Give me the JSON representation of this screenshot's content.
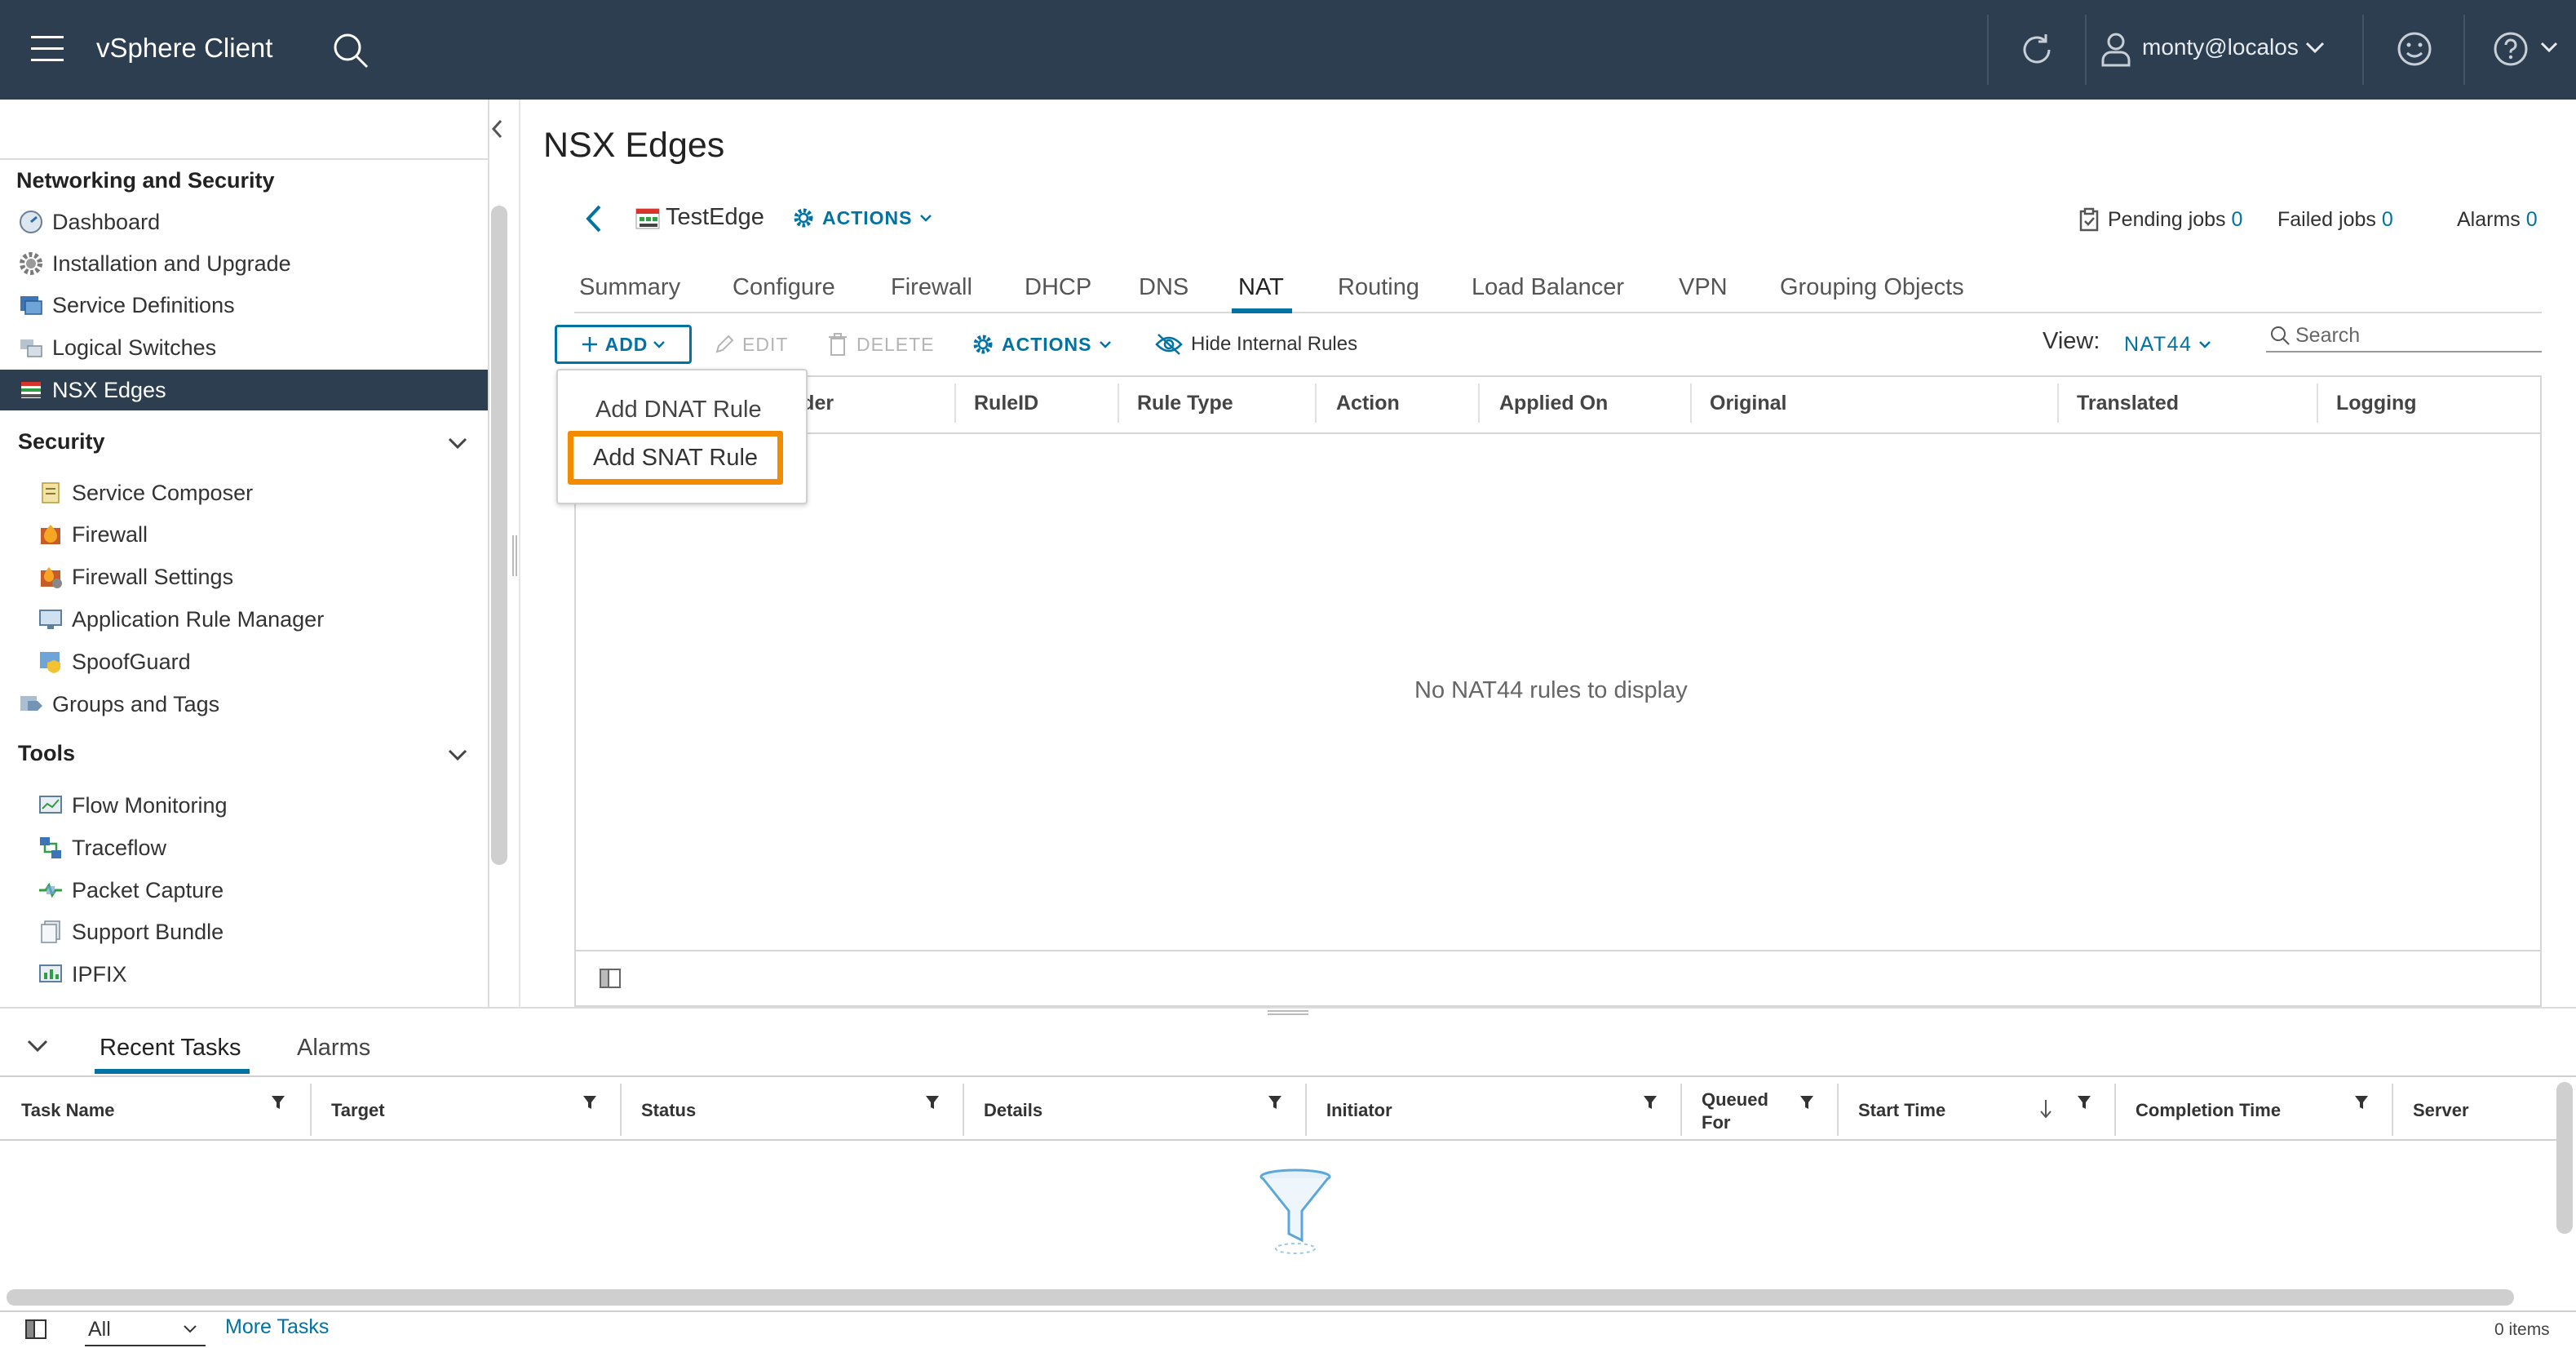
{
  "header": {
    "app_title": "vSphere Client",
    "user": "monty@localos"
  },
  "sidebar": {
    "section_main": "Networking and Security",
    "items": [
      "Dashboard",
      "Installation and Upgrade",
      "Service Definitions",
      "Logical Switches",
      "NSX Edges"
    ],
    "security_label": "Security",
    "security_items": [
      "Service Composer",
      "Firewall",
      "Firewall Settings",
      "Application Rule Manager",
      "SpoofGuard"
    ],
    "groups_label": "Groups and Tags",
    "tools_label": "Tools",
    "tools_items": [
      "Flow Monitoring",
      "Traceflow",
      "Packet Capture",
      "Support Bundle",
      "IPFIX"
    ]
  },
  "main": {
    "page_title": "NSX Edges",
    "edge_name": "TestEdge",
    "actions_label": "ACTIONS",
    "pending_jobs_label": "Pending jobs",
    "pending_jobs_count": "0",
    "failed_jobs_label": "Failed jobs",
    "failed_jobs_count": "0",
    "alarms_label": "Alarms",
    "alarms_count": "0",
    "tabs": [
      "Summary",
      "Configure",
      "Firewall",
      "DHCP",
      "DNS",
      "NAT",
      "Routing",
      "Load Balancer",
      "VPN",
      "Grouping Objects"
    ],
    "active_tab": "NAT",
    "toolbar": {
      "add": "ADD",
      "edit": "EDIT",
      "delete": "DELETE",
      "actions": "ACTIONS",
      "hide_internal": "Hide Internal Rules",
      "view_label": "View:",
      "view_value": "NAT44",
      "search_placeholder": "Search"
    },
    "dropdown": [
      "Add DNAT Rule",
      "Add SNAT Rule"
    ],
    "columns": [
      "Order",
      "RuleID",
      "Rule Type",
      "Action",
      "Applied On",
      "Original",
      "Translated",
      "Logging"
    ],
    "empty_text": "No NAT44 rules to display"
  },
  "bottom": {
    "tabs": [
      "Recent Tasks",
      "Alarms"
    ],
    "columns": [
      "Task Name",
      "Target",
      "Status",
      "Details",
      "Initiator",
      "Queued For",
      "Start Time",
      "Completion Time",
      "Server"
    ],
    "filter_value": "All",
    "more_tasks": "More Tasks",
    "items_count": "0 items"
  },
  "colors": {
    "header_bg": "#2c3e50",
    "accent_blue": "#0072a3",
    "highlight_orange": "#f38b00",
    "selected_nav_bg": "#2c3e50"
  }
}
